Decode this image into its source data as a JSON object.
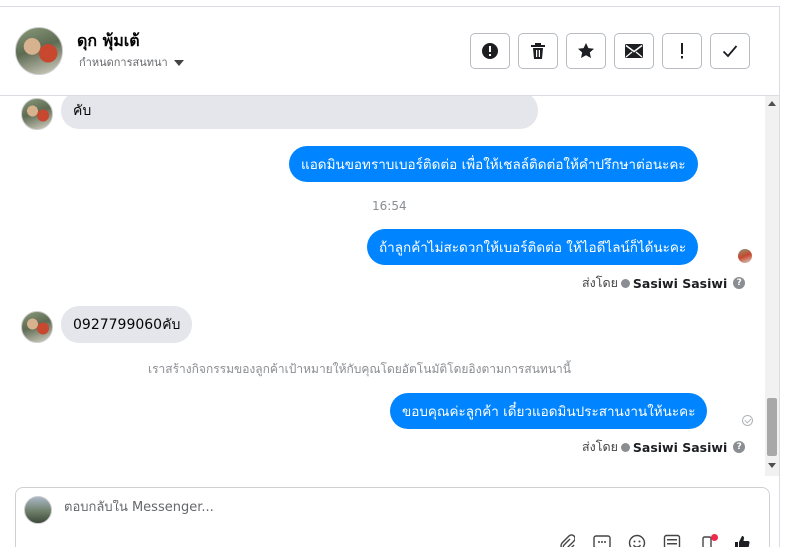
{
  "header": {
    "contact_name": "ดุก พุ้มเต้",
    "assign_label": "กำหนดการสนทนา",
    "actions": [
      {
        "name": "spam-button",
        "icon": "alert-circle-icon"
      },
      {
        "name": "delete-button",
        "icon": "trash-icon"
      },
      {
        "name": "star-button",
        "icon": "star-icon"
      },
      {
        "name": "mark-unread-button",
        "icon": "envelope-icon"
      },
      {
        "name": "follow-up-button",
        "icon": "exclamation-icon"
      },
      {
        "name": "done-button",
        "icon": "checkmark-icon"
      }
    ]
  },
  "messages": {
    "m1_text": "คับ",
    "m2_text": "แอดมินขอทราบเบอร์ติดต่อ เพื่อให้เชลล์ติดต่อให้คำปรึกษาต่อนะคะ",
    "time_1": "16:54",
    "m3_text": "ถ้าลูกค้าไม่สะดวกให้เบอร์ติดต่อ ให้ไอดีไลน์ก็ได้นะคะ",
    "sent_by_label": "ส่งโดย",
    "sent_by_name": "Sasiwi Sasiwi",
    "m4_text": "0927799060คับ",
    "system_note": "เราสร้างกิจกรรมของลูกค้าเป้าหมายให้กับคุณโดยอัตโนมัติโดยอิงตามการสนทนานี้",
    "m5_text": "ขอบคุณค่ะลูกค้า เดี๋ยวแอดมินประสานงานให้นะคะ",
    "help_glyph": "?"
  },
  "composer": {
    "placeholder": "ตอบกลับใน Messenger...",
    "tools": [
      "paperclip-icon",
      "saved-replies-icon",
      "emoji-icon",
      "template-icon",
      "notification-icon",
      "like-icon"
    ]
  },
  "colors": {
    "outgoing_bubble": "#0084ff",
    "incoming_bubble": "#e4e6eb",
    "badge": "#f02849"
  }
}
